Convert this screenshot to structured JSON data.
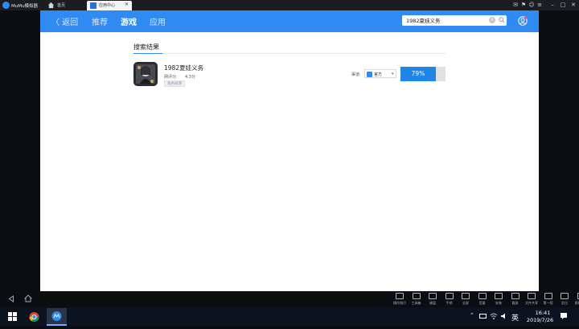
{
  "titlebar": {
    "app_title": "MuMu模拟器",
    "home_label": "首页",
    "active_tab_label": "应用中心"
  },
  "header": {
    "back_label": "〈 返回",
    "nav": [
      {
        "label": "推荐",
        "active": false
      },
      {
        "label": "游戏",
        "active": true
      },
      {
        "label": "应用",
        "active": false
      }
    ],
    "search": {
      "value": "1982夏娃义务"
    }
  },
  "results": {
    "section_title": "搜索结果",
    "items": [
      {
        "title": "1982夏娃义务",
        "rating_label": "网评分:",
        "rating_value": "4.3分",
        "tag": "角色扮演",
        "channel_label": "渠道:",
        "channel_value": "官方",
        "progress_percent": 79,
        "progress_text": "79%"
      }
    ]
  },
  "toolbar": {
    "tools": [
      {
        "label": "操作指引",
        "icon": "cursor-icon"
      },
      {
        "label": "工具箱",
        "icon": "toolbox-icon"
      },
      {
        "label": "键盘",
        "icon": "keyboard-icon"
      },
      {
        "label": "手柄",
        "icon": "gamepad-icon"
      },
      {
        "label": "全屏",
        "icon": "fullscreen-icon"
      },
      {
        "label": "音量",
        "icon": "volume-icon"
      },
      {
        "label": "安装",
        "icon": "apk-icon"
      },
      {
        "label": "截屏",
        "icon": "crop-icon"
      },
      {
        "label": "文件共享",
        "icon": "folder-icon"
      },
      {
        "label": "第一视",
        "icon": "camera-icon"
      },
      {
        "label": "定位",
        "icon": "location-icon"
      },
      {
        "label": "屏幕旋转",
        "icon": "rotate-icon"
      }
    ]
  },
  "taskbar": {
    "ime": "英",
    "time": "16:41",
    "date": "2019/7/26"
  },
  "colors": {
    "accent": "#2f8bf1",
    "progress": "#1f86e8"
  }
}
